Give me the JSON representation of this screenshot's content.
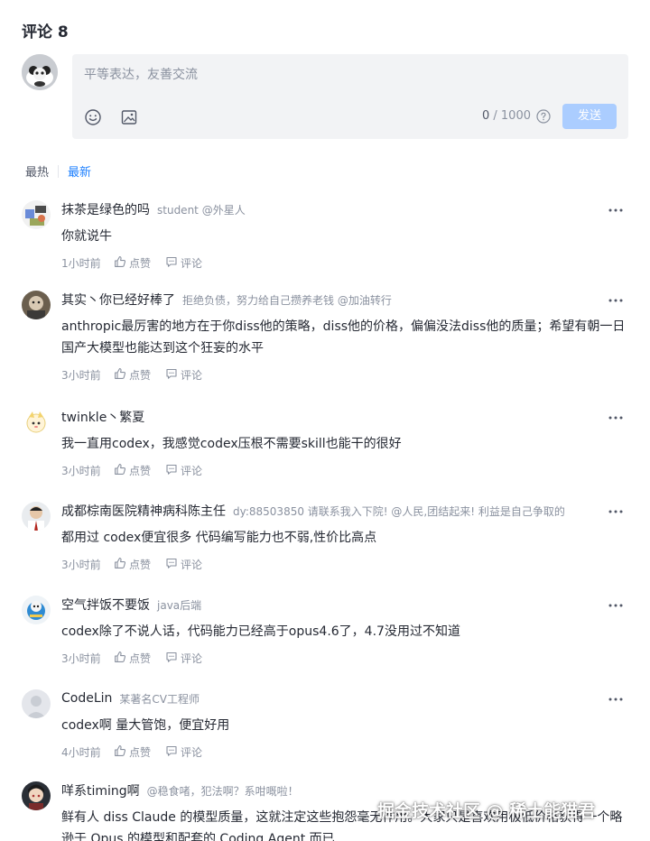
{
  "header": {
    "title": "评论 8"
  },
  "editor": {
    "placeholder": "平等表达，友善交流",
    "count_current": "0",
    "count_max": " / 1000",
    "send_label": "发送",
    "emoji_icon": "smile-icon",
    "image_icon": "image-icon",
    "help_icon": "question-circle-icon"
  },
  "sort": {
    "hot": "最热",
    "new": "最新"
  },
  "action_labels": {
    "like": "点赞",
    "comment": "评论"
  },
  "comments": [
    {
      "name": "抹茶是绿色的吗",
      "info": "student @外星人",
      "text": "你就说牛",
      "time": "1小时前"
    },
    {
      "name": "其实丶你已经好棒了",
      "info": "拒绝负债，努力给自己攒养老钱 @加油转行",
      "text": "anthropic最厉害的地方在于你diss他的策略，diss他的价格，偏偏没法diss他的质量；希望有朝一日国产大模型也能达到这个狂妄的水平",
      "time": "3小时前"
    },
    {
      "name": "twinkle丶繁夏",
      "info": "",
      "text": "我一直用codex，我感觉codex压根不需要skill也能干的很好",
      "time": "3小时前"
    },
    {
      "name": "成都棕南医院精神病科陈主任",
      "info": "dy:88503850 请联系我入下院! @人民,团结起来! 利益是自己争取的",
      "text": "都用过 codex便宜很多 代码编写能力也不弱,性价比高点",
      "time": "3小时前"
    },
    {
      "name": "空气拌饭不要饭",
      "info": "java后端",
      "text": "codex除了不说人话，代码能力已经高于opus4.6了，4.7没用过不知道",
      "time": "3小时前"
    },
    {
      "name": "CodeLin",
      "info": "某著名CV工程师",
      "text": "codex啊 量大管饱，便宜好用",
      "time": "4小时前"
    },
    {
      "name": "咩系timing啊",
      "info": "@稳食啫，犯法啊？系咁嘅啦！",
      "text": "鲜有人 diss Claude 的模型质量，这就注定这些抱怨毫无作用。大家只是喜欢用极低价格获得一个略逊于 Opus 的模型和配套的 Coding Agent 而已",
      "time": ""
    }
  ],
  "watermark": "掘金技术社区 @ 稀土能猫君",
  "colors": {
    "accent": "#1e80ff",
    "send_disabled": "#abcdff",
    "muted": "#8a919f"
  }
}
